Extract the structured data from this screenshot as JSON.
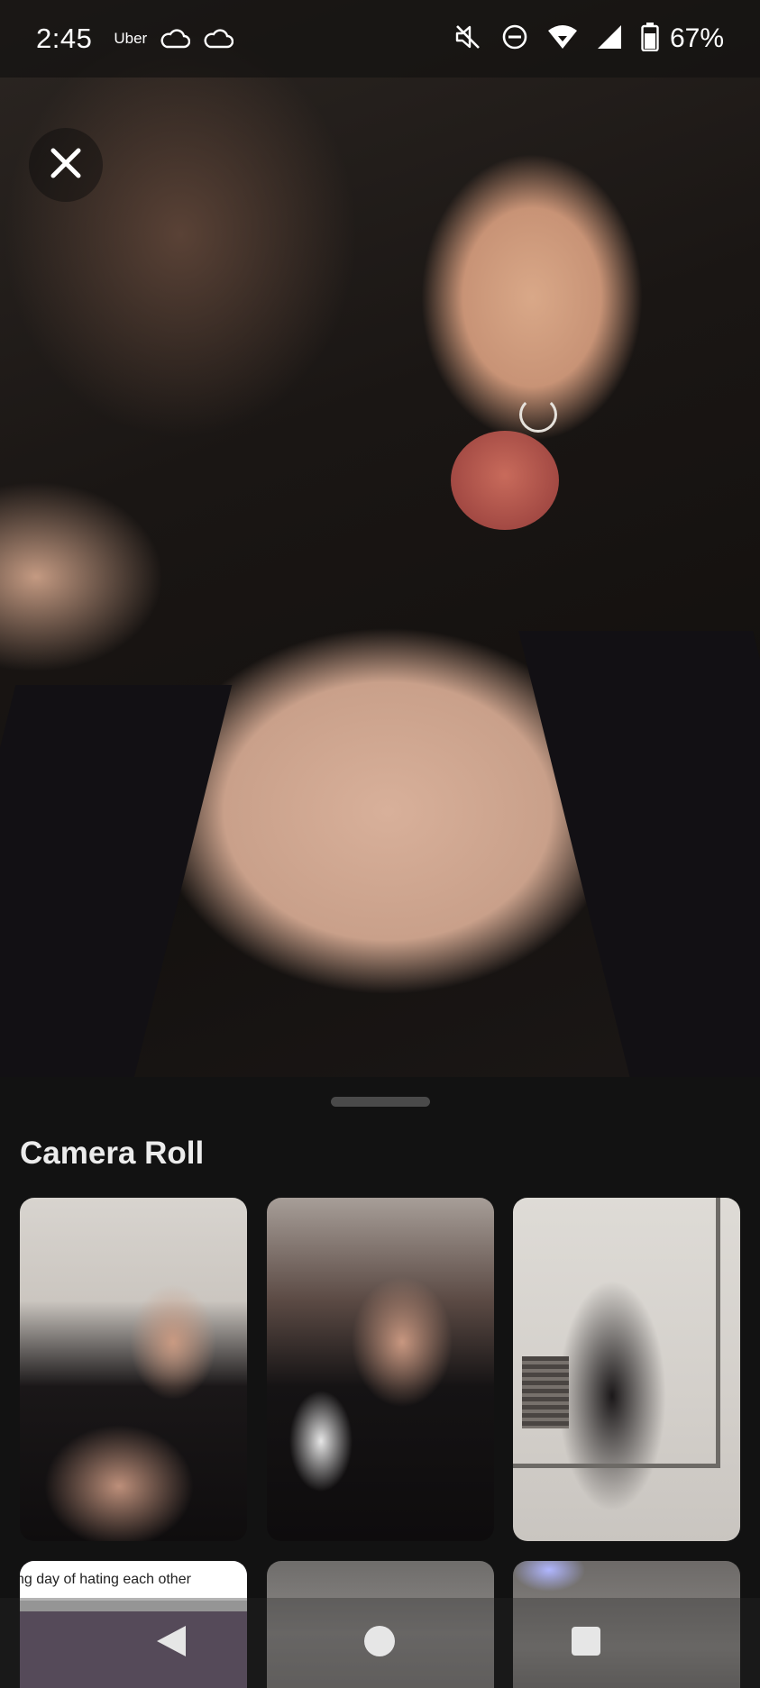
{
  "status_bar": {
    "time": "2:45",
    "app_label": "Uber",
    "battery": "67%"
  },
  "preview": {
    "close_icon": "close-icon"
  },
  "camera_roll": {
    "title": "Camera Roll",
    "thumbnails": [
      {
        "caption": ""
      },
      {
        "caption": ""
      },
      {
        "caption": ""
      },
      {
        "caption": "ng day of hating each other"
      },
      {
        "caption": ""
      },
      {
        "caption": ""
      }
    ]
  },
  "nav_bar": {
    "back_icon": "back-triangle-icon",
    "home_icon": "home-circle-icon",
    "recents_icon": "recents-square-icon"
  },
  "colors": {
    "sheet_background": "#121212",
    "title_text": "#ececec",
    "handle": "#4a4a4a"
  }
}
